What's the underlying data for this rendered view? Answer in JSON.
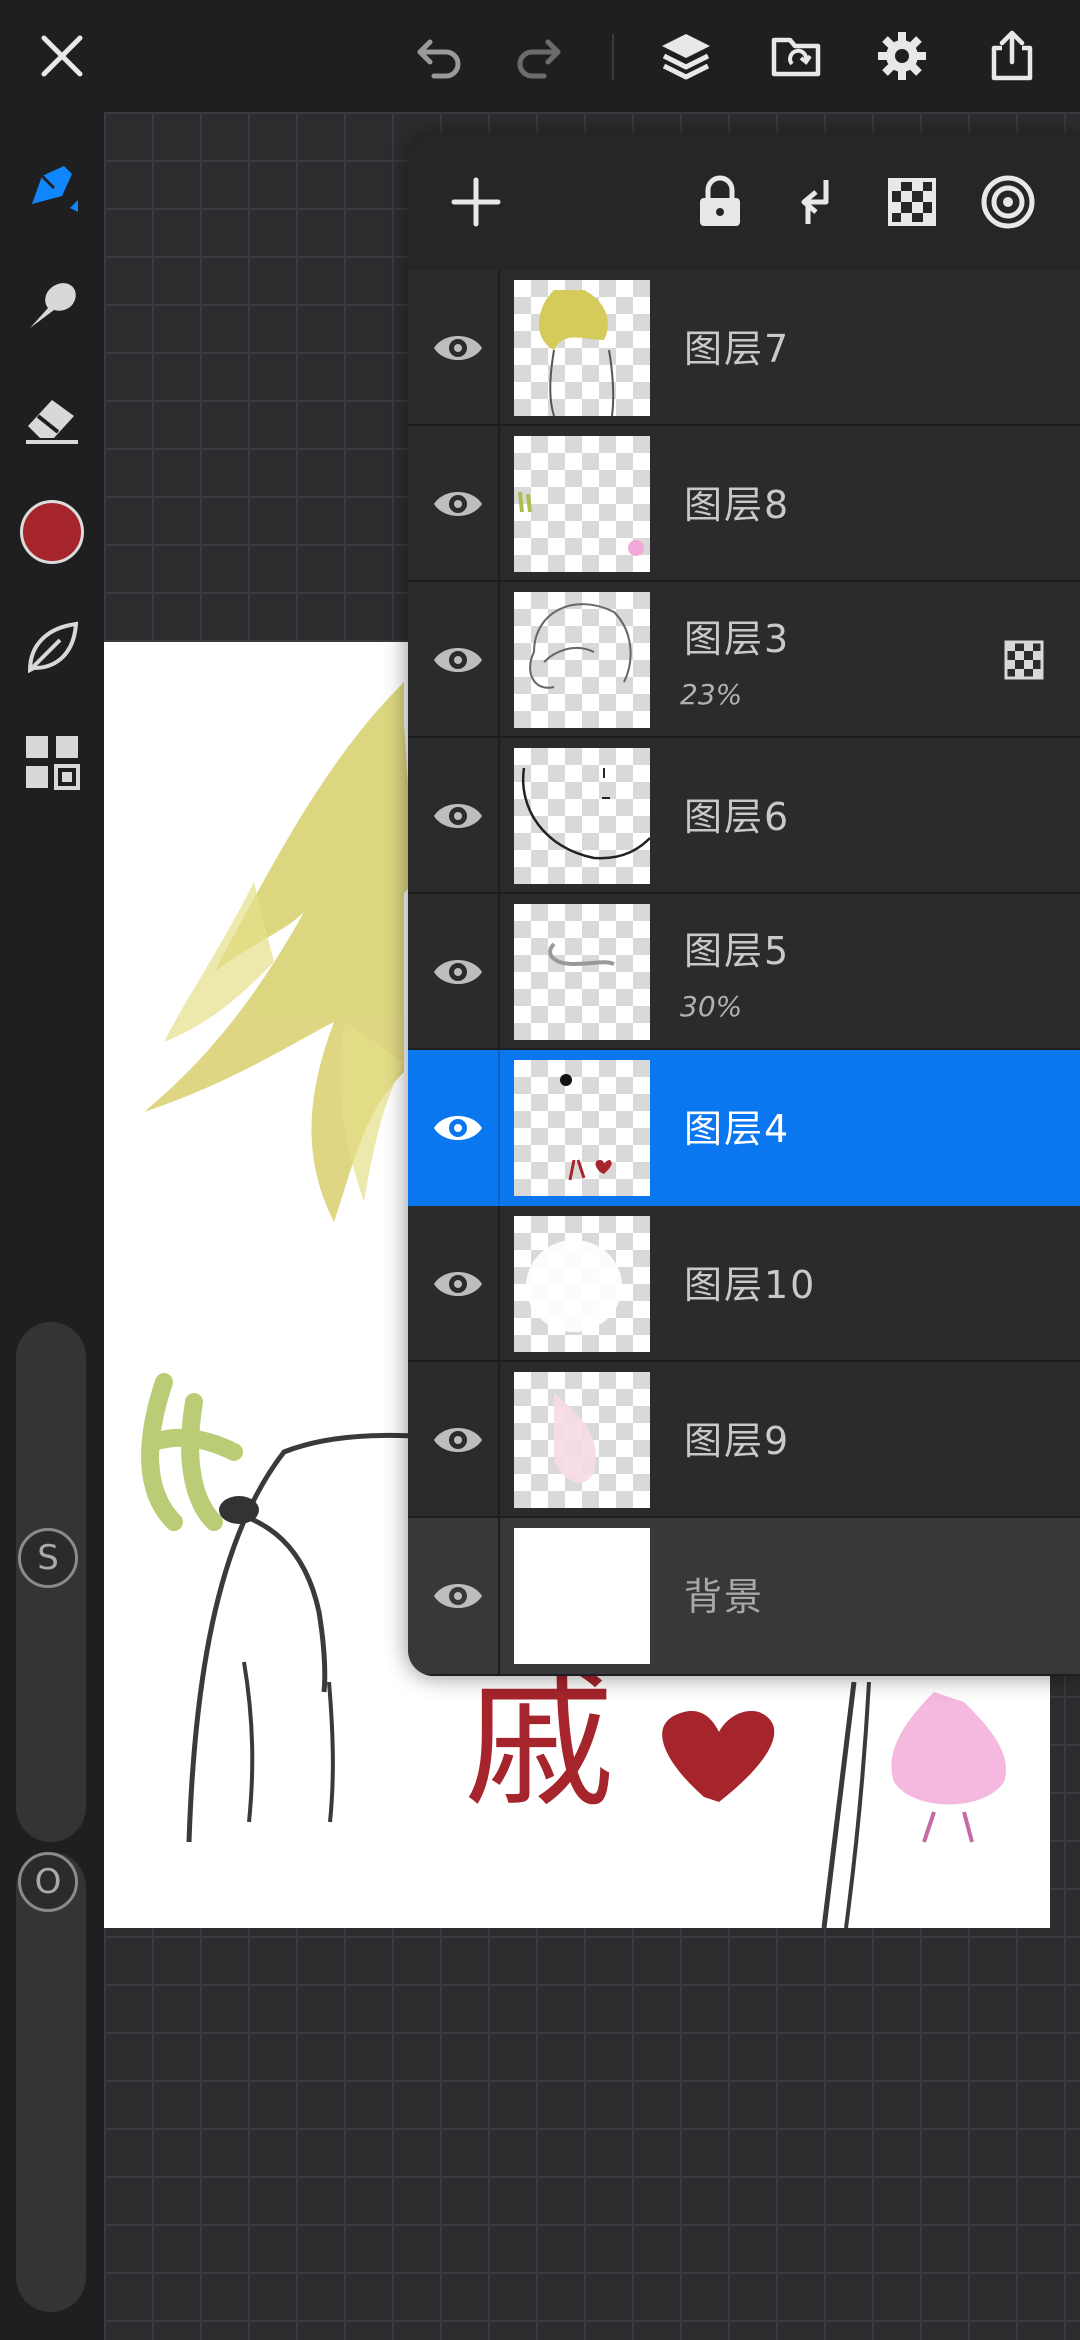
{
  "app": {
    "top_bar": {
      "icons": [
        "close-icon",
        "undo-icon",
        "redo-icon",
        "layers-icon",
        "import-icon",
        "settings-icon",
        "share-icon"
      ]
    },
    "left_toolbar": {
      "tools": [
        "brush-icon",
        "smudge-icon",
        "eraser-icon",
        "color-swatch",
        "fill-leaf-icon",
        "quick-menu-icon"
      ],
      "current_color": "#a6242c",
      "size_slider_label": "S",
      "opacity_slider_label": "O"
    },
    "layers_panel": {
      "header_icons": [
        "add-layer-icon",
        "lock-icon",
        "merge-down-icon",
        "alpha-lock-icon",
        "clipping-mask-icon"
      ],
      "layers": [
        {
          "name": "图层7",
          "opacity": "",
          "visible": true,
          "selected": false
        },
        {
          "name": "图层8",
          "opacity": "",
          "visible": true,
          "selected": false
        },
        {
          "name": "图层3",
          "opacity": "23%",
          "visible": true,
          "selected": false,
          "clipping": true
        },
        {
          "name": "图层6",
          "opacity": "",
          "visible": true,
          "selected": false
        },
        {
          "name": "图层5",
          "opacity": "30%",
          "visible": true,
          "selected": false
        },
        {
          "name": "图层4",
          "opacity": "",
          "visible": true,
          "selected": true
        },
        {
          "name": "图层10",
          "opacity": "",
          "visible": true,
          "selected": false
        },
        {
          "name": "图层9",
          "opacity": "",
          "visible": true,
          "selected": false
        },
        {
          "name": "背景",
          "opacity": "",
          "visible": true,
          "selected": false
        }
      ]
    },
    "canvas": {
      "accent_color": "#0a76f0",
      "sketch_text": "戚"
    }
  }
}
